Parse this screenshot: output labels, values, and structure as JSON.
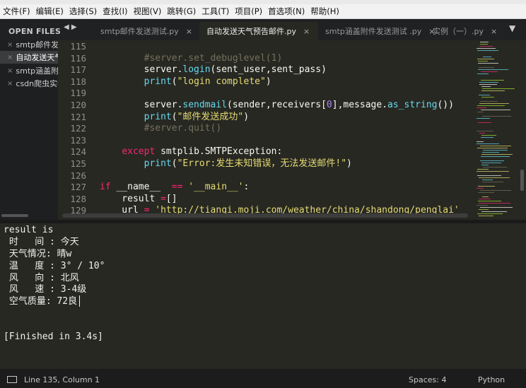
{
  "menubar": {
    "items": [
      "文件(F)",
      "编辑(E)",
      "选择(S)",
      "查找(I)",
      "视图(V)",
      "跳转(G)",
      "工具(T)",
      "项目(P)",
      "首选项(N)",
      "帮助(H)"
    ]
  },
  "sidebar": {
    "heading": "OPEN FILES",
    "close_glyph": "×",
    "files": [
      {
        "label": "smtp邮件发送测试.py"
      },
      {
        "label": "自动发送天气预告邮件.py"
      },
      {
        "label": "smtp涵盖附件发送测试.py"
      },
      {
        "label": "csdn爬虫实例"
      }
    ]
  },
  "tabs": [
    {
      "label": "smtp邮件发送测试.py",
      "close": "×"
    },
    {
      "label": "自动发送天气预告邮件.py",
      "close": "×"
    },
    {
      "label": "smtp涵盖附件发送测试 .py",
      "close": "×"
    },
    {
      "label": "实例（一）.py",
      "close": "×"
    }
  ],
  "tab_nav": "◀ ▶",
  "tab_dropdown": "▼",
  "editor": {
    "line_numbers": [
      "115",
      "116",
      "117",
      "118",
      "119",
      "120",
      "121",
      "122",
      "123",
      "124",
      "125",
      "126",
      "127",
      "128",
      "129"
    ],
    "lines": [
      [],
      [
        {
          "t": "        "
        },
        {
          "t": "#server.set_debuglevel(1)",
          "c": "cm"
        }
      ],
      [
        {
          "t": "        server."
        },
        {
          "t": "login",
          "c": "fn"
        },
        {
          "t": "(sent_user,sent_pass)"
        }
      ],
      [
        {
          "t": "        "
        },
        {
          "t": "print",
          "c": "fn"
        },
        {
          "t": "("
        },
        {
          "t": "\"login complete\"",
          "c": "st"
        },
        {
          "t": ")"
        }
      ],
      [],
      [
        {
          "t": "        server."
        },
        {
          "t": "sendmail",
          "c": "fn"
        },
        {
          "t": "(sender,receivers["
        },
        {
          "t": "0",
          "c": "nm"
        },
        {
          "t": "],message."
        },
        {
          "t": "as_string",
          "c": "fn"
        },
        {
          "t": "())"
        }
      ],
      [
        {
          "t": "        "
        },
        {
          "t": "print",
          "c": "fn"
        },
        {
          "t": "("
        },
        {
          "t": "\"邮件发送成功\"",
          "c": "st"
        },
        {
          "t": ")"
        }
      ],
      [
        {
          "t": "        "
        },
        {
          "t": "#server.quit()",
          "c": "cm"
        }
      ],
      [],
      [
        {
          "t": "    "
        },
        {
          "t": "except",
          "c": "kw"
        },
        {
          "t": " smtplib.SMTPException:"
        }
      ],
      [
        {
          "t": "        "
        },
        {
          "t": "print",
          "c": "fn"
        },
        {
          "t": "("
        },
        {
          "t": "\"Error:发生未知错误，无法发送邮件!\"",
          "c": "st"
        },
        {
          "t": ")"
        }
      ],
      [],
      [
        {
          "t": "if",
          "c": "kw"
        },
        {
          "t": " __name__  "
        },
        {
          "t": "==",
          "c": "kw"
        },
        {
          "t": " "
        },
        {
          "t": "'__main__'",
          "c": "st"
        },
        {
          "t": ":"
        }
      ],
      [
        {
          "t": "    result "
        },
        {
          "t": "=",
          "c": "kw"
        },
        {
          "t": "[]"
        }
      ],
      [
        {
          "t": "    url "
        },
        {
          "t": "=",
          "c": "kw"
        },
        {
          "t": " "
        },
        {
          "t": "'http://tianqi.moji.com/weather/china/shandong/penglai'",
          "c": "st"
        }
      ]
    ]
  },
  "console": {
    "lines": [
      "result is",
      " 时   间 : 今天",
      " 天气情况: 晴w",
      " 温   度 : 3° / 10°",
      " 风   向 : 北风",
      " 风   速 : 3-4级",
      " 空气质量: 72良",
      "",
      "",
      "[Finished in 3.4s]"
    ]
  },
  "statusbar": {
    "position": "Line 135, Column 1",
    "indent": "Spaces: 4",
    "syntax": "Python"
  },
  "colors": {
    "background": "#272822",
    "comment": "#75715e",
    "keyword": "#f92672",
    "function": "#66d9ef",
    "string": "#e6db74",
    "number": "#ae81ff"
  }
}
